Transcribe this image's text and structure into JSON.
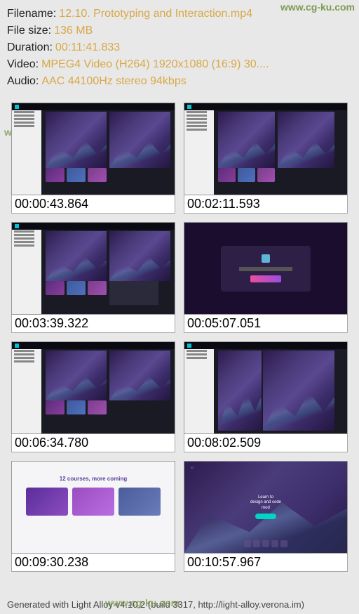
{
  "info": {
    "filename_label": "Filename:",
    "filename_value": "12.10. Prototyping and Interaction.mp4",
    "filesize_label": "File size:",
    "filesize_value": "136 MB",
    "duration_label": "Duration:",
    "duration_value": "00:11:41.833",
    "video_label": "Video:",
    "video_value": "MPEG4 Video (H264) 1920x1080 (16:9) 30....",
    "audio_label": "Audio:",
    "audio_value": "AAC 44100Hz stereo 94kbps"
  },
  "watermark": "www.cg-ku.com",
  "thumbs": [
    {
      "time": "00:00:43.864"
    },
    {
      "time": "00:02:11.593"
    },
    {
      "time": "00:03:39.322"
    },
    {
      "time": "00:05:07.051"
    },
    {
      "time": "00:06:34.780"
    },
    {
      "time": "00:08:02.509"
    },
    {
      "time": "00:09:30.238"
    },
    {
      "time": "00:10:57.967"
    }
  ],
  "light_section_title": "12 courses, more coming",
  "footer": "Generated with Light Alloy v4.10.2 (build 3317, http://light-alloy.verona.im)"
}
